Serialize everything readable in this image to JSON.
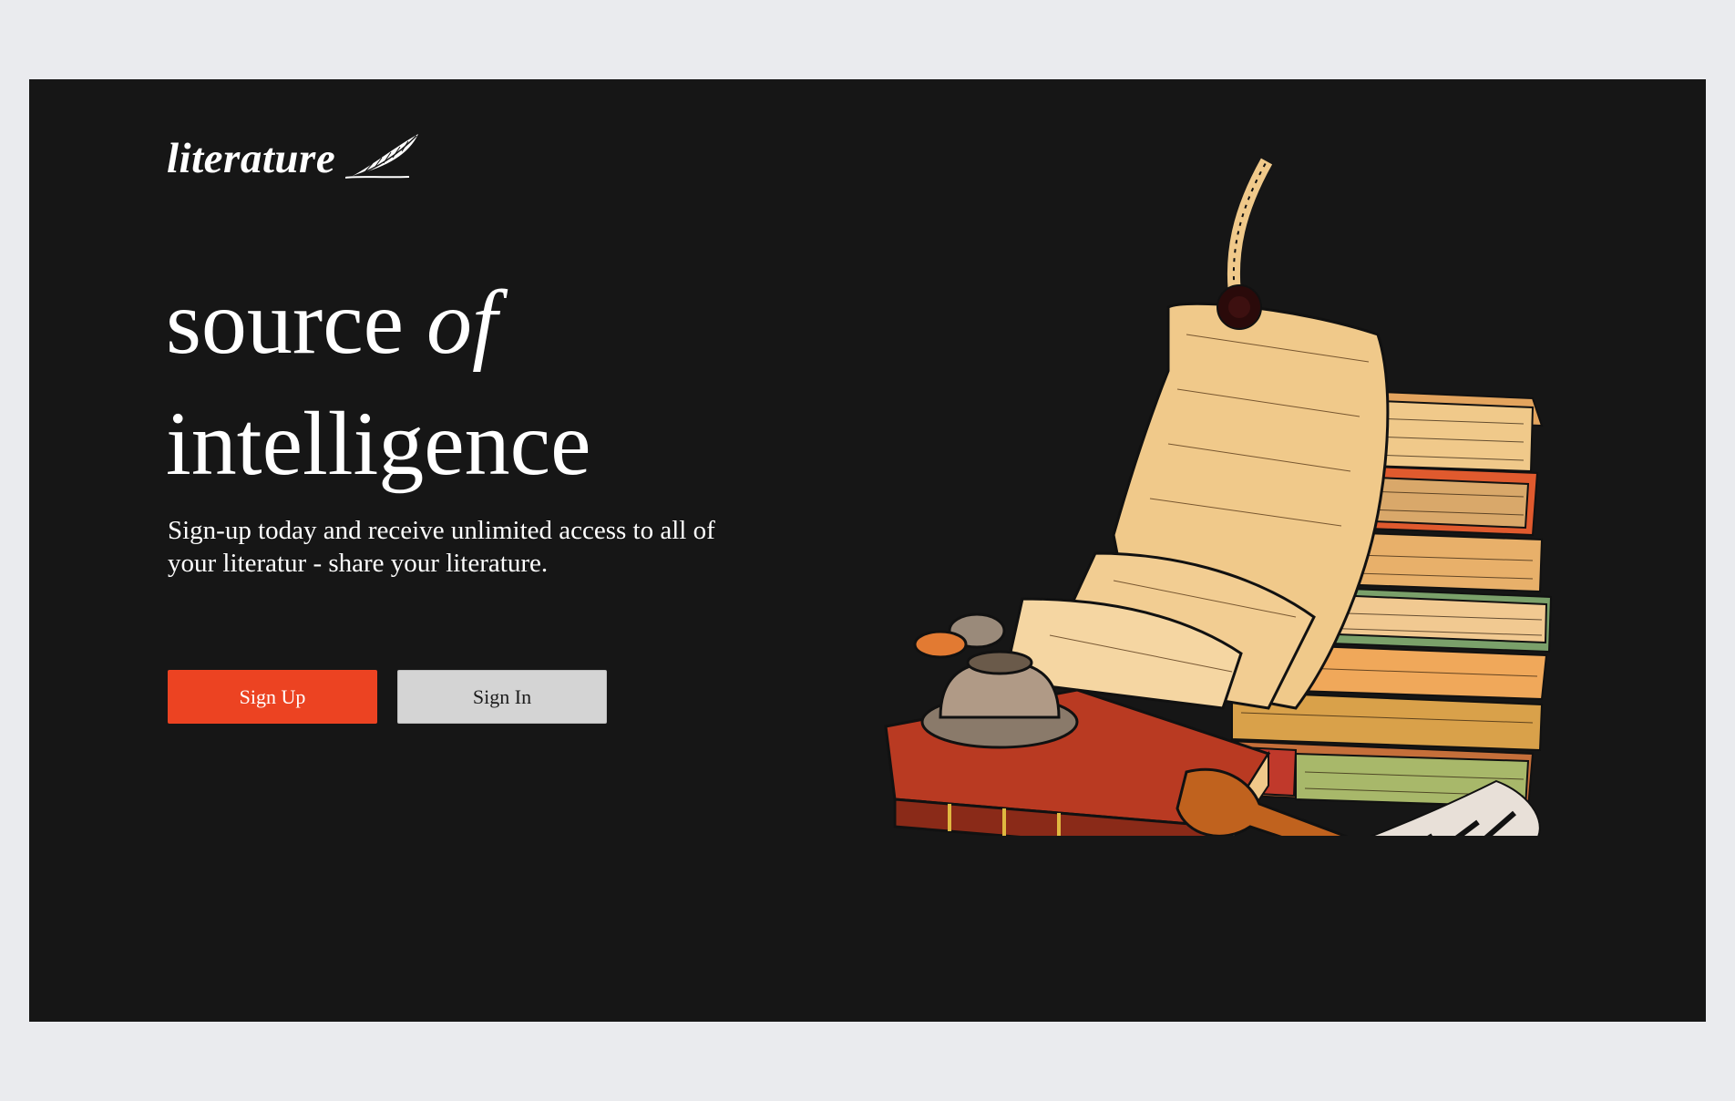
{
  "brand": {
    "name": "literature",
    "logo_icon": "quill-feather-icon"
  },
  "hero": {
    "headline_part1": "source ",
    "headline_part2": "of",
    "headline_part3": "intelligence",
    "subtitle": "Sign-up today and receive unlimited access to all of your literatur - share your literature."
  },
  "actions": {
    "signup_label": "Sign Up",
    "signin_label": "Sign In"
  },
  "illustration": {
    "name": "books-scroll-inkwell-illustration"
  },
  "colors": {
    "page_background": "#eaebee",
    "card_background": "#161616",
    "accent": "#ec4322",
    "secondary_button": "#d4d4d4",
    "text_primary": "#ffffff"
  }
}
